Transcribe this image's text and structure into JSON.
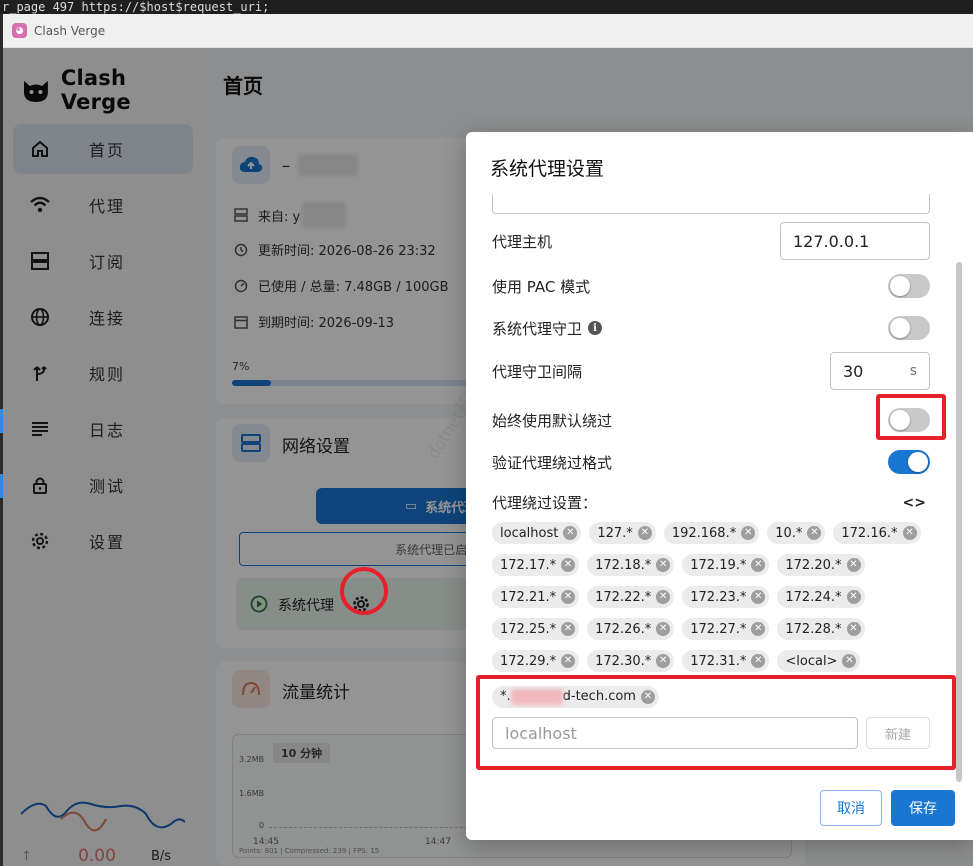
{
  "terminal": {
    "text": "r_page 497  https://$host$request_uri;"
  },
  "window": {
    "title": "Clash Verge",
    "badge": "◕"
  },
  "sidebar": {
    "brand": "Clash Verge",
    "items": [
      {
        "label": "首页",
        "icon": "home-icon"
      },
      {
        "label": "代理",
        "icon": "wifi-icon"
      },
      {
        "label": "订阅",
        "icon": "server-icon"
      },
      {
        "label": "连接",
        "icon": "globe-icon"
      },
      {
        "label": "规则",
        "icon": "route-icon"
      },
      {
        "label": "日志",
        "icon": "list-icon"
      },
      {
        "label": "测试",
        "icon": "lock-icon"
      },
      {
        "label": "设置",
        "icon": "gear-icon"
      }
    ],
    "traffic": {
      "up_value": "0.00",
      "up_unit": "B/s"
    }
  },
  "main": {
    "title": "首页",
    "profile_card": {
      "name_prefix": "–",
      "from_label": "来自: y",
      "updated": "更新时间: 2026-08-26 23:32",
      "usage": "已使用 / 总量: 7.48GB / 100GB",
      "expire": "到期时间: 2026-09-13",
      "percent_text": "7%",
      "percent": 7
    },
    "network_card": {
      "title": "网络设置",
      "mode_button": "系统代理",
      "status_text": "系统代理已启用,",
      "sysproxy_label": "系统代理"
    },
    "traffic_card": {
      "title": "流量统计",
      "range": "10 分钟",
      "y_ticks": [
        "3.2MB",
        "1.6MB",
        "0"
      ],
      "x_ticks": [
        "14:45",
        "14:47"
      ],
      "footer": "Points: 801 | Compressed: 239 | FPS: 15"
    }
  },
  "dialog": {
    "title": "系统代理设置",
    "proxy_host_label": "代理主机",
    "proxy_host_value": "127.0.0.1",
    "pac_label": "使用 PAC 模式",
    "guard_label": "系统代理守卫",
    "guard_interval_label": "代理守卫间隔",
    "guard_interval_value": "30",
    "guard_interval_unit": "s",
    "default_bypass_label": "始终使用默认绕过",
    "validate_bypass_label": "验证代理绕过格式",
    "bypass_settings_label": "代理绕过设置：",
    "bypass_toggle_icon": "<>",
    "bypass_rows": [
      [
        "localhost",
        "127.*",
        "192.168.*",
        "10.*",
        "172.16.*"
      ],
      [
        "172.17.*",
        "172.18.*",
        "172.19.*",
        "172.20.*"
      ],
      [
        "172.21.*",
        "172.22.*",
        "172.23.*",
        "172.24.*"
      ],
      [
        "172.25.*",
        "172.26.*",
        "172.27.*",
        "172.28.*"
      ],
      [
        "172.29.*",
        "172.30.*",
        "172.31.*",
        "<local>"
      ]
    ],
    "custom_chip_prefix": "*.",
    "custom_chip_suffix": "d-tech.com",
    "new_input_placeholder": "localhost",
    "new_button": "新建",
    "cancel_button": "取消",
    "save_button": "保存"
  },
  "watermark": "dotnet开发框架 www.yesdotnet.com",
  "colors": {
    "accent": "#1976d2",
    "annotation": "#e5202a"
  }
}
